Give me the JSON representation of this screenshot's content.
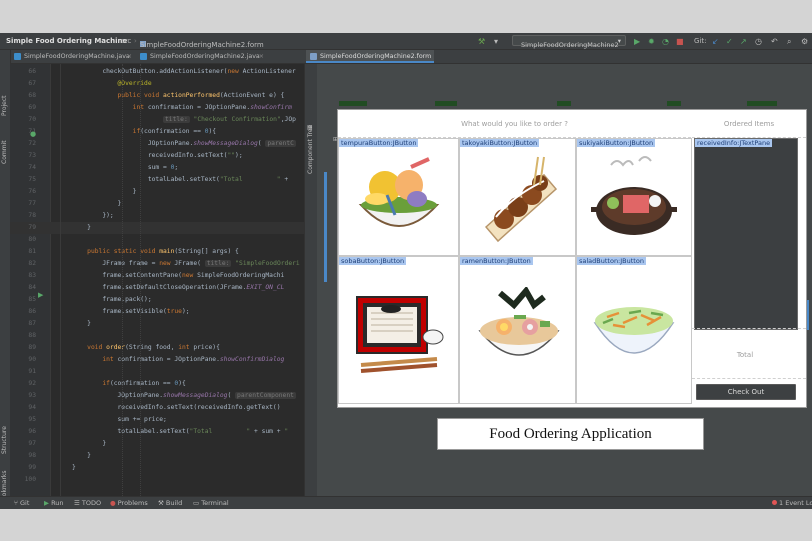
{
  "toolbar": {
    "project": "Simple Food Ordering Machine",
    "src": "src",
    "form_file": "SimpleFoodOrderingMachine2.form",
    "run_config": "SimpleFoodOrderingMachine2",
    "git_label": "Git:"
  },
  "tabs": [
    {
      "label": "SimpleFoodOrderingMachine.java",
      "icon": "java-file-icon"
    },
    {
      "label": "SimpleFoodOrderingMachine2.java",
      "icon": "java-file-icon"
    },
    {
      "label": "SimpleFoodOrderingMachine2.form",
      "icon": "form-file-icon"
    }
  ],
  "left_strip": [
    "Project",
    "Commit",
    "Structure",
    "Bookmarks"
  ],
  "designer_strip": "Component Tree",
  "code_lines": [
    {
      "n": "66",
      "html": "        checkOutButton.addActionListener(<span class='k'>new</span> ActionListener"
    },
    {
      "n": "67",
      "html": "            <span class='a'>@Override</span>"
    },
    {
      "n": "68",
      "html": "            <span class='k'>public void</span> <span class='f'>actionPerformed</span>(ActionEvent e) {"
    },
    {
      "n": "69",
      "html": "                <span class='k'>int</span> confirmation = JOptionPane.<span class='i'>showConfirm</span>"
    },
    {
      "n": "70",
      "html": "                        <span class='hint'>title:</span> <span class='s'>\"Checkout Confirmation\"</span>,JOp"
    },
    {
      "n": "71",
      "html": "                <span class='k'>if</span>(confirmation == <span class='num'>0</span>){"
    },
    {
      "n": "72",
      "html": "                    JOptionPane.<span class='i'>showMessageDialog</span>( <span class='hint'>parentC</span>"
    },
    {
      "n": "73",
      "html": "                    receivedInfo.setText(<span class='s'>\"\"</span>);"
    },
    {
      "n": "74",
      "html": "                    sum = <span class='num'>0</span>;"
    },
    {
      "n": "75",
      "html": "                    totalLabel.setText(<span class='s'>\"Total         \"</span> +"
    },
    {
      "n": "76",
      "html": "                }"
    },
    {
      "n": "77",
      "html": "            }"
    },
    {
      "n": "78",
      "html": "        });"
    },
    {
      "n": "79",
      "html": "    }"
    },
    {
      "n": "80",
      "html": ""
    },
    {
      "n": "81",
      "html": "    <span class='k'>public static void</span> <span class='f'>main</span>(String[] args) {"
    },
    {
      "n": "82",
      "html": "        JFrame frame = <span class='k'>new</span> JFrame( <span class='hint'>title:</span> <span class='s'>\"SimpleFoodOrderi</span>"
    },
    {
      "n": "83",
      "html": "        frame.setContentPane(<span class='k'>new</span> SimpleFoodOrderingMachi"
    },
    {
      "n": "84",
      "html": "        frame.setDefaultCloseOperation(JFrame.<span class='i'>EXIT_ON_CL</span>"
    },
    {
      "n": "85",
      "html": "        frame.pack();"
    },
    {
      "n": "86",
      "html": "        frame.setVisible(<span class='k'>true</span>);"
    },
    {
      "n": "87",
      "html": "    }"
    },
    {
      "n": "88",
      "html": ""
    },
    {
      "n": "89",
      "html": "    <span class='k'>void</span> <span class='f'>order</span>(String food, <span class='k'>int</span> price){"
    },
    {
      "n": "90",
      "html": "        <span class='k'>int</span> confirmation = JOptionPane.<span class='i'>showConfirmDialog</span>"
    },
    {
      "n": "91",
      "html": ""
    },
    {
      "n": "92",
      "html": "        <span class='k'>if</span>(confirmation == <span class='num'>0</span>){"
    },
    {
      "n": "93",
      "html": "            JOptionPane.<span class='i'>showMessageDialog</span>( <span class='hint'>parentComponent</span>"
    },
    {
      "n": "94",
      "html": "            receivedInfo.setText(receivedInfo.getText()"
    },
    {
      "n": "95",
      "html": "            sum += price;"
    },
    {
      "n": "96",
      "html": "            totalLabel.setText(<span class='s'>\"Total         \"</span> + sum + <span class='s'>\"</span>"
    },
    {
      "n": "97",
      "html": "        }"
    },
    {
      "n": "98",
      "html": "    }"
    },
    {
      "n": "99",
      "html": "}"
    },
    {
      "n": "100",
      "html": ""
    }
  ],
  "designer": {
    "prompt": "What would you like to order ?",
    "ordered_items": "Ordered Items",
    "text_pane_label": "receivedInfo:JTextPane",
    "total": "Total",
    "checkout": "Check Out",
    "app_title": "Food Ordering Application",
    "foods": [
      {
        "label": "tempuraButton:JButton",
        "icon": "tempura-bowl-icon"
      },
      {
        "label": "takoyakiButton:JButton",
        "icon": "takoyaki-icon"
      },
      {
        "label": "sukiyakiButton:JButton",
        "icon": "sukiyaki-pot-icon"
      },
      {
        "label": "sobaButton:JButton",
        "icon": "soba-tray-icon"
      },
      {
        "label": "ramenButton:JButton",
        "icon": "ramen-bowl-icon"
      },
      {
        "label": "saladButton:JButton",
        "icon": "salad-bowl-icon"
      }
    ]
  },
  "statusbar": {
    "git": "Git",
    "run": "Run",
    "todo": "TODO",
    "problems": "Problems",
    "build": "Build",
    "terminal": "Terminal",
    "event_log": "Event Log",
    "event_count": "1"
  },
  "colors": {
    "ide_bg": "#2b2b2b",
    "panel": "#3c3f41",
    "selection": "#a9c6ef",
    "accent": "#4a88c7"
  }
}
